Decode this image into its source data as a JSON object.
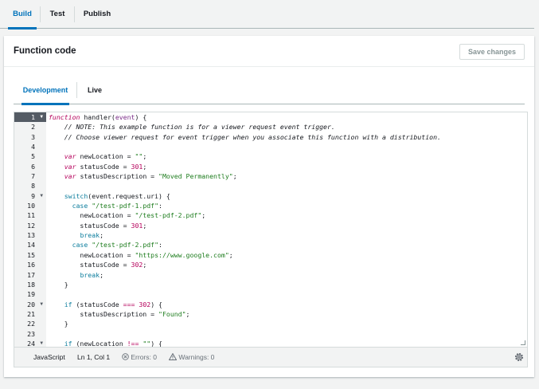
{
  "top_tabs": [
    {
      "label": "Build",
      "active": true
    },
    {
      "label": "Test",
      "active": false
    },
    {
      "label": "Publish",
      "active": false
    }
  ],
  "panel": {
    "title": "Function code",
    "save_button": "Save changes"
  },
  "sub_tabs": [
    {
      "label": "Development",
      "active": true
    },
    {
      "label": "Live",
      "active": false
    }
  ],
  "editor": {
    "active_line": 1,
    "lines": [
      {
        "n": "1",
        "fold": true,
        "html": "<span class=\"kw\">function</span> handler(<span class=\"var\">event</span>) {"
      },
      {
        "n": "2",
        "fold": false,
        "html": "    <span class=\"cmt\">// NOTE: This example function is for a viewer request event trigger.</span>"
      },
      {
        "n": "3",
        "fold": false,
        "html": "    <span class=\"cmt\">// Choose viewer request for event trigger when you associate this function with a distribution.</span>"
      },
      {
        "n": "4",
        "fold": false,
        "html": ""
      },
      {
        "n": "5",
        "fold": false,
        "html": "    <span class=\"kw\">var</span> newLocation = <span class=\"str\">\"\"</span>;"
      },
      {
        "n": "6",
        "fold": false,
        "html": "    <span class=\"kw\">var</span> statusCode = <span class=\"num\">301</span>;"
      },
      {
        "n": "7",
        "fold": false,
        "html": "    <span class=\"kw\">var</span> statusDescription = <span class=\"str\">\"Moved Permanently\"</span>;"
      },
      {
        "n": "8",
        "fold": false,
        "html": ""
      },
      {
        "n": "9",
        "fold": true,
        "html": "    <span class=\"kw2\">switch</span>(event.request.uri) {"
      },
      {
        "n": "10",
        "fold": false,
        "html": "      <span class=\"kw2\">case</span> <span class=\"str\">\"/test-pdf-1.pdf\"</span>:"
      },
      {
        "n": "11",
        "fold": false,
        "html": "        newLocation = <span class=\"str\">\"/test-pdf-2.pdf\"</span>;"
      },
      {
        "n": "12",
        "fold": false,
        "html": "        statusCode = <span class=\"num\">301</span>;"
      },
      {
        "n": "13",
        "fold": false,
        "html": "        <span class=\"kw2\">break</span>;"
      },
      {
        "n": "14",
        "fold": false,
        "html": "      <span class=\"kw2\">case</span> <span class=\"str\">\"/test-pdf-2.pdf\"</span>:"
      },
      {
        "n": "15",
        "fold": false,
        "html": "        newLocation = <span class=\"str\">\"https://www.google.com\"</span>;"
      },
      {
        "n": "16",
        "fold": false,
        "html": "        statusCode = <span class=\"num\">302</span>;"
      },
      {
        "n": "17",
        "fold": false,
        "html": "        <span class=\"kw2\">break</span>;"
      },
      {
        "n": "18",
        "fold": false,
        "html": "    }"
      },
      {
        "n": "19",
        "fold": false,
        "html": ""
      },
      {
        "n": "20",
        "fold": true,
        "html": "    <span class=\"kw2\">if</span> (statusCode <span class=\"op\">===</span> <span class=\"num\">302</span>) {"
      },
      {
        "n": "21",
        "fold": false,
        "html": "        statusDescription = <span class=\"str\">\"Found\"</span>;"
      },
      {
        "n": "22",
        "fold": false,
        "html": "    }"
      },
      {
        "n": "23",
        "fold": false,
        "html": ""
      },
      {
        "n": "24",
        "fold": true,
        "html": "    <span class=\"kw2\">if</span> (newLocation <span class=\"op\">!==</span> <span class=\"str\">\"\"</span>) {"
      }
    ]
  },
  "statusbar": {
    "language": "JavaScript",
    "cursor": "Ln 1, Col 1",
    "errors": "Errors: 0",
    "warnings": "Warnings: 0"
  },
  "colors": {
    "accent": "#0073bb",
    "background": "#f2f3f3",
    "panel": "#ffffff"
  },
  "icons": {
    "fold": "triangle-down-icon",
    "errors": "circle-x-icon",
    "warnings": "warning-triangle-icon",
    "settings": "gear-icon"
  }
}
